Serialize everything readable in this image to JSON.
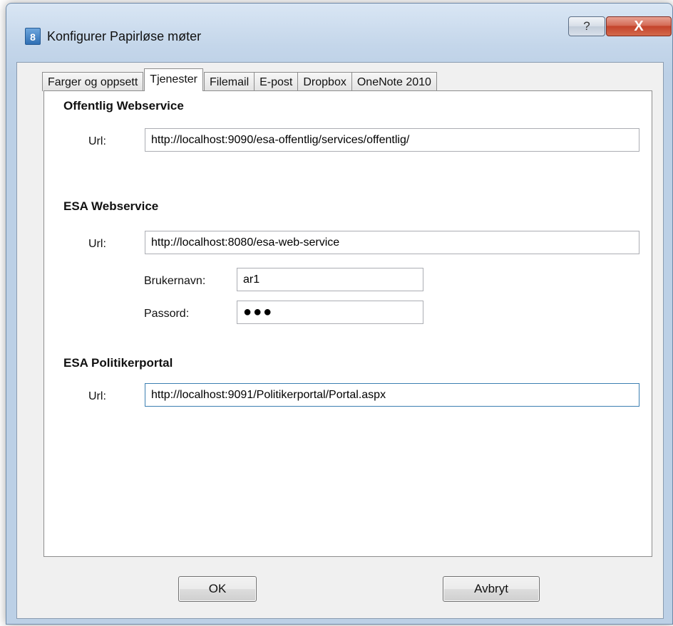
{
  "window": {
    "title": "Konfigurer Papirløse møter",
    "icon_text": "8",
    "help_glyph": "?",
    "close_glyph": "X"
  },
  "tabs": [
    {
      "label": "Farger og oppsett",
      "active": false
    },
    {
      "label": "Tjenester",
      "active": true
    },
    {
      "label": "Filemail",
      "active": false
    },
    {
      "label": "E-post",
      "active": false
    },
    {
      "label": "Dropbox",
      "active": false
    },
    {
      "label": "OneNote 2010",
      "active": false
    }
  ],
  "offentlig": {
    "title": "Offentlig Webservice",
    "url_label": "Url:",
    "url_value": "http://localhost:9090/esa-offentlig/services/offentlig/"
  },
  "esa": {
    "title": "ESA Webservice",
    "url_label": "Url:",
    "url_value": "http://localhost:8080/esa-web-service",
    "username_label": "Brukernavn:",
    "username_value": "ar1",
    "password_label": "Passord:",
    "password_value": "●●●"
  },
  "politiker": {
    "title": "ESA Politikerportal",
    "url_label": "Url:",
    "url_value": "http://localhost:9091/Politikerportal/Portal.aspx"
  },
  "buttons": {
    "ok": "OK",
    "cancel": "Avbryt"
  }
}
